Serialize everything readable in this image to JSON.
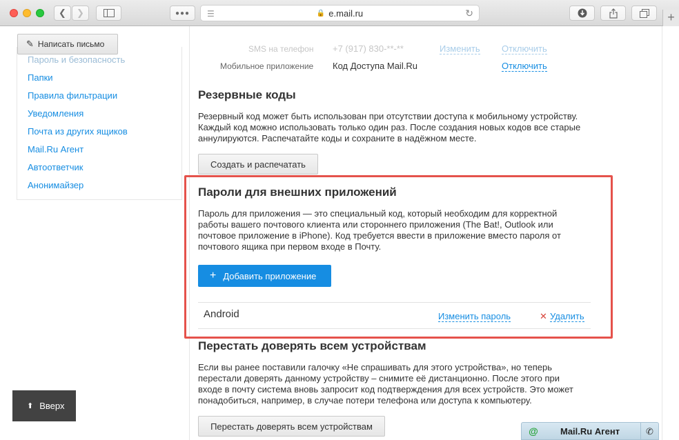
{
  "browser": {
    "url": "e.mail.ru",
    "new_tab": "+"
  },
  "compose": {
    "label": "Написать письмо"
  },
  "sidebar": {
    "items": [
      {
        "label": "Пароль и безопасность"
      },
      {
        "label": "Папки"
      },
      {
        "label": "Правила фильтрации"
      },
      {
        "label": "Уведомления"
      },
      {
        "label": "Почта из других ящиков"
      },
      {
        "label": "Mail.Ru Агент"
      },
      {
        "label": "Автоответчик"
      },
      {
        "label": "Анонимайзер"
      }
    ]
  },
  "twofa": {
    "sms": {
      "label": "SMS на телефон",
      "value": "+7 (917) 830-**-**",
      "change": "Изменить",
      "disable": "Отключить"
    },
    "app": {
      "label": "Мобильное приложение",
      "value": "Код Доступа Mail.Ru",
      "disable": "Отключить"
    }
  },
  "backup": {
    "title": "Резервные коды",
    "text": "Резервный код может быть использован при отсутствии доступа к мобильному устройству. Каждый код можно использовать только один раз. После создания новых кодов все старые аннулируются. Распечатайте коды и сохраните в надёжном месте.",
    "button": "Создать и распечатать"
  },
  "app_passwords": {
    "title": "Пароли для внешних приложений",
    "text": "Пароль для приложения — это специальный код, который необходим для корректной работы вашего почтового клиента или стороннего приложения (The Bat!, Outlook или почтовое приложение в iPhone). Код требуется ввести в приложение вместо пароля от почтового ящика при первом входе в Почту.",
    "add_button": "Добавить приложение",
    "apps": [
      {
        "name": "Android",
        "change": "Изменить пароль",
        "delete": "Удалить"
      }
    ]
  },
  "untrust": {
    "title": "Перестать доверять всем устройствам",
    "text": "Если вы ранее поставили галочку «Не спрашивать для этого устройства», но теперь перестали доверять данному устройству – снимите её дистанционно. После этого при входе в почту система вновь запросит код подтверждения для всех устройств. Это может понадобиться, например, в случае потери телефона или доступа к компьютеру.",
    "button": "Перестать доверять всем устройствам"
  },
  "scroll_up": {
    "label": "Вверх"
  },
  "agent_bar": {
    "label": "Mail.Ru Агент"
  },
  "colors": {
    "accent": "#168de2",
    "highlight_border": "#e5524b",
    "delete_x": "#d8453b"
  }
}
